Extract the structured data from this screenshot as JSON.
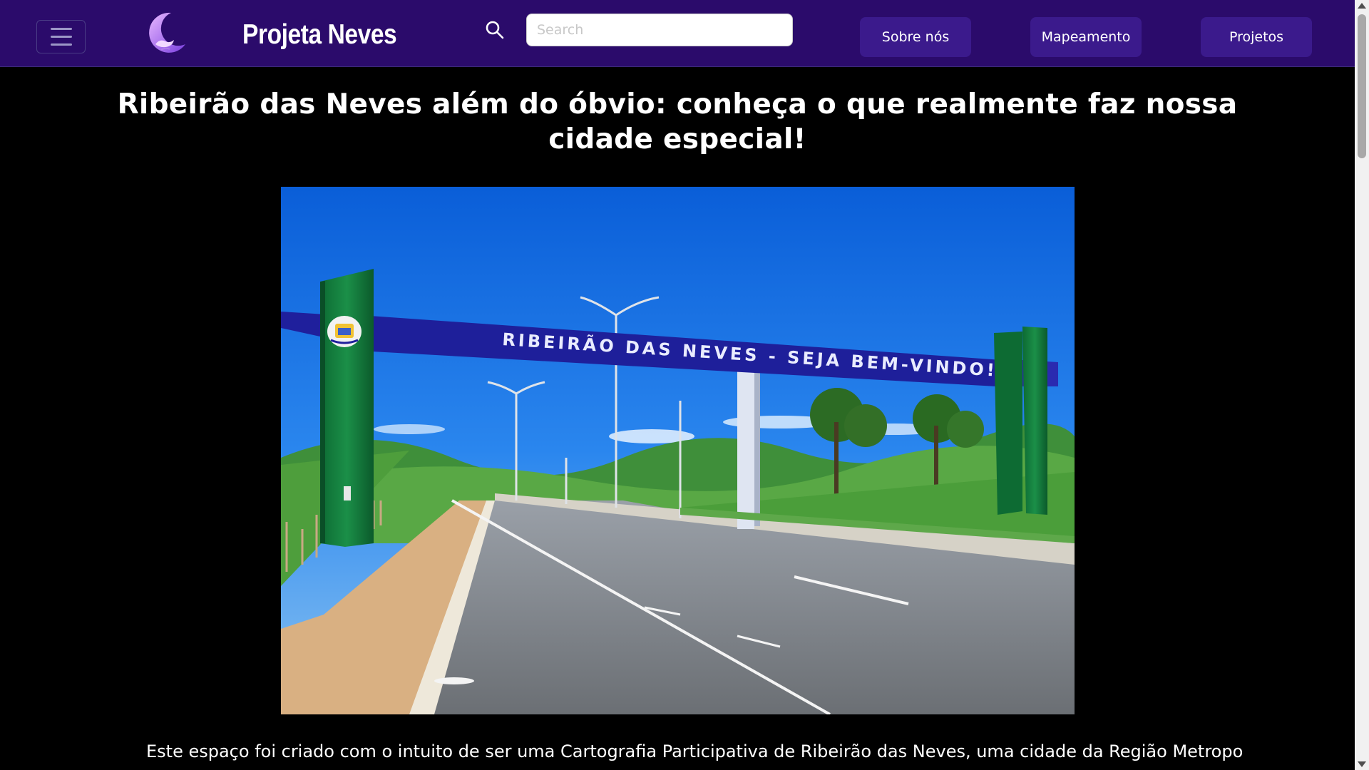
{
  "header": {
    "brand": "Projeta Neves",
    "search_placeholder": "Search",
    "nav": [
      "Sobre nós",
      "Mapeamento",
      "Projetos"
    ]
  },
  "main": {
    "title": "Ribeirão das Neves além do óbvio: conheça o que realmente faz nossa cidade especial!",
    "hero_sign_text": "RIBEIRÃO DAS NEVES - SEJA BEM-VINDO!",
    "intro": "Este espaço foi criado com o intuito de ser uma Cartografia Participativa de Ribeirão das Neves, uma cidade da Região Metropolitana de"
  },
  "colors": {
    "navbar": "#2b0b6b",
    "nav_button": "#3b1a8c",
    "page_background": "#000000",
    "arch_blue": "#1e1f9a",
    "arch_green": "#0f7a3a"
  },
  "icons": [
    "hamburger-menu-icon",
    "moon-hands-logo",
    "search-icon"
  ]
}
